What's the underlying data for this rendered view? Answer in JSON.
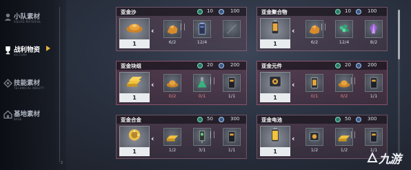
{
  "sidebar": {
    "items": [
      {
        "label": "小队素材",
        "sub": "SQUAD MATERIAL",
        "active": false,
        "icon": "squad-icon"
      },
      {
        "label": "战利物资",
        "sub": "VICTORY",
        "active": true,
        "icon": "trophy-icon"
      },
      {
        "label": "技能素材",
        "sub": "TECHNICAL ABILITY",
        "active": false,
        "icon": "skill-icon"
      },
      {
        "label": "基地素材",
        "sub": "BASE",
        "active": false,
        "icon": "base-icon"
      }
    ],
    "page_indicator": "2"
  },
  "cost_icons": {
    "green": "green-currency-icon",
    "blue": "blue-currency-icon"
  },
  "cards": [
    {
      "name": "亚金沙",
      "cost_green": "10",
      "cost_blue": "100",
      "owned": "1",
      "main_icon": "orange-sand-pile-icon",
      "ingredients": [
        {
          "icon": "orange-ore-icon",
          "req": "6/2"
        },
        {
          "icon": "battery-cell-icon",
          "req": "12/4"
        },
        {
          "icon": "empty-slot-icon",
          "req": ""
        }
      ]
    },
    {
      "name": "亚金聚合物",
      "cost_green": "10",
      "cost_blue": "100",
      "owned": "1",
      "main_icon": "fuel-canister-icon",
      "ingredients": [
        {
          "icon": "orange-ore-icon",
          "req": "6/2"
        },
        {
          "icon": "green-crystal-icon",
          "req": "12/4"
        },
        {
          "icon": "purple-crystal-icon",
          "req": "8/2"
        }
      ]
    },
    {
      "name": "亚金块组",
      "cost_green": "20",
      "cost_blue": "200",
      "owned": "1",
      "main_icon": "gold-bars-icon",
      "ingredients": [
        {
          "icon": "orange-sand-icon",
          "req": "0/2",
          "lack": true
        },
        {
          "icon": "green-flask-icon",
          "req": "0/1",
          "lack": true
        },
        {
          "icon": "dark-module-icon",
          "req": "1/1"
        }
      ]
    },
    {
      "name": "亚金元件",
      "cost_green": "20",
      "cost_blue": "200",
      "owned": "1",
      "main_icon": "gear-component-icon",
      "ingredients": [
        {
          "icon": "fuel-canister-icon",
          "req": "0/1",
          "lack": true
        },
        {
          "icon": "orange-sand-icon",
          "req": "0/2",
          "lack": true
        },
        {
          "icon": "dark-module-icon",
          "req": "1/1"
        }
      ]
    },
    {
      "name": "亚金合金",
      "cost_green": "50",
      "cost_blue": "300",
      "owned": "1",
      "main_icon": "gold-alloy-icon",
      "ingredients": [
        {
          "icon": "gold-bars-icon",
          "req": "1/2"
        },
        {
          "icon": "circuit-chip-icon",
          "req": "3/1"
        },
        {
          "icon": "dark-module-icon",
          "req": "1/1"
        }
      ]
    },
    {
      "name": "亚金电池",
      "cost_green": "50",
      "cost_blue": "300",
      "owned": "1",
      "main_icon": "yellow-battery-icon",
      "ingredients": [
        {
          "icon": "gear-component-icon",
          "req": "1/2"
        },
        {
          "icon": "gold-bars-icon",
          "req": "1/2"
        },
        {
          "icon": "dark-module-icon",
          "req": "1/1"
        }
      ]
    }
  ],
  "watermark": "九游"
}
